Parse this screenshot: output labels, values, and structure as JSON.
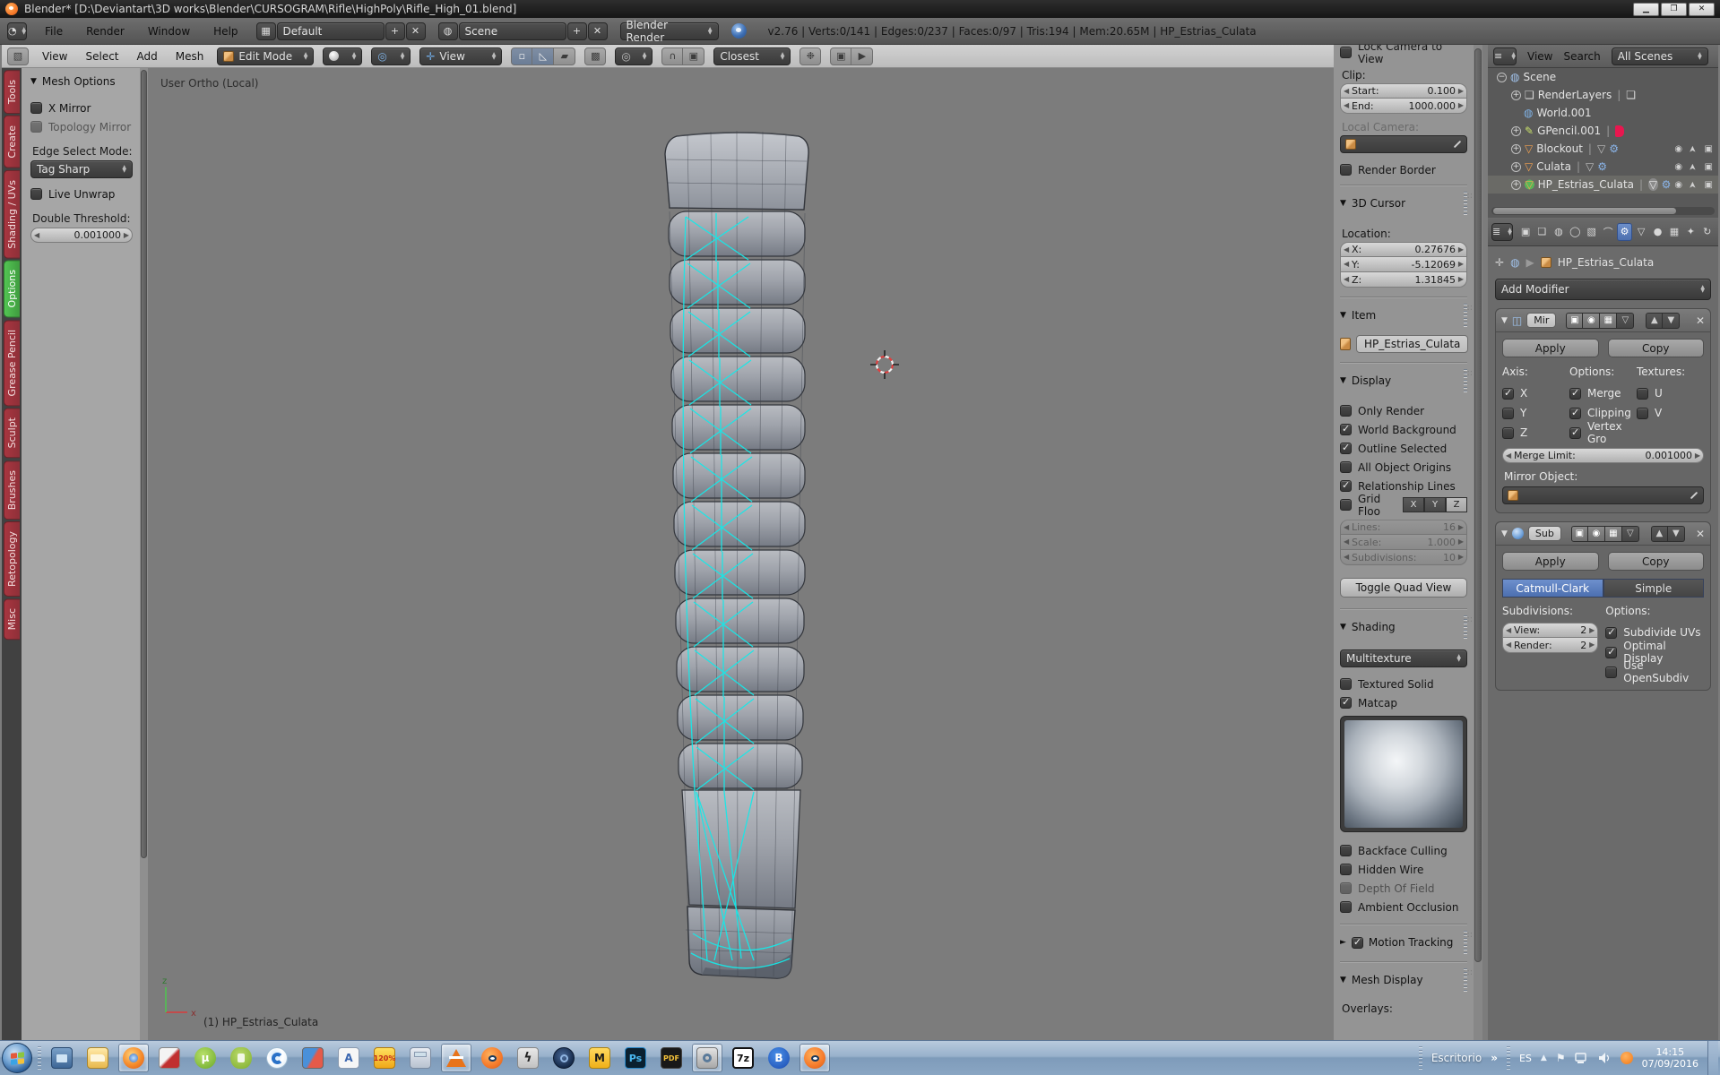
{
  "window": {
    "title": "Blender* [D:\\Deviantart\\3D works\\Blender\\CURSOGRAM\\Rifle\\HighPoly\\Rifle_High_01.blend]"
  },
  "info": {
    "menus": [
      "File",
      "Render",
      "Window",
      "Help"
    ],
    "layout": "Default",
    "scene": "Scene",
    "engine": "Blender Render",
    "stats": "v2.76 | Verts:0/141 | Edges:0/237 | Faces:0/97 | Tris:194 | Mem:20.65M | HP_Estrias_Culata"
  },
  "viewhdr": {
    "menus": [
      "View",
      "Select",
      "Add",
      "Mesh"
    ],
    "mode": "Edit Mode",
    "orientation": "View",
    "snap": "Closest"
  },
  "tools": {
    "tabs": [
      "Tools",
      "Create",
      "Shading / UVs",
      "Options",
      "Grease Pencil",
      "Sculpt",
      "Brushes",
      "Retopology",
      "Misc"
    ],
    "active_tab": "Options",
    "panel": "Mesh Options",
    "x_mirror": "X Mirror",
    "topology_mirror": "Topology Mirror",
    "edge_mode_label": "Edge Select Mode:",
    "edge_mode": "Tag Sharp",
    "live_unwrap": "Live Unwrap",
    "threshold_label": "Double Threshold:",
    "threshold": "0.001000"
  },
  "viewport": {
    "view_label": "User Ortho (Local)",
    "object_label": "(1) HP_Estrias_Culata"
  },
  "npanel": {
    "lock_camera": "Lock Camera to View",
    "clip": "Clip:",
    "start_label": "Start:",
    "start": "0.100",
    "end_label": "End:",
    "end": "1000.000",
    "local_camera": "Local Camera:",
    "render_border": "Render Border",
    "cursor": "3D Cursor",
    "location": "Location:",
    "loc": [
      {
        "k": "X:",
        "v": "0.27676"
      },
      {
        "k": "Y:",
        "v": "-5.12069"
      },
      {
        "k": "Z:",
        "v": "1.31845"
      }
    ],
    "item": "Item",
    "item_name": "HP_Estrias_Culata",
    "display": "Display",
    "display_items": [
      {
        "label": "Only Render",
        "on": false
      },
      {
        "label": "World Background",
        "on": true
      },
      {
        "label": "Outline Selected",
        "on": true
      },
      {
        "label": "All Object Origins",
        "on": false
      },
      {
        "label": "Relationship Lines",
        "on": true
      }
    ],
    "grid_floor": "Grid Floo",
    "axes": [
      "X",
      "Y",
      "Z"
    ],
    "grid_sliders": [
      {
        "k": "Lines:",
        "v": "16"
      },
      {
        "k": "Scale:",
        "v": "1.000"
      },
      {
        "k": "Subdivisions:",
        "v": "10"
      }
    ],
    "toggle_quad": "Toggle Quad View",
    "shading": "Shading",
    "shading_mode": "Multitexture",
    "textured_solid": "Textured Solid",
    "matcap": "Matcap",
    "shade_items": [
      {
        "label": "Backface Culling",
        "on": false
      },
      {
        "label": "Hidden Wire",
        "on": false
      },
      {
        "label": "Depth Of Field",
        "on": false
      },
      {
        "label": "Ambient Occlusion",
        "on": false
      }
    ],
    "motion_tracking": "Motion Tracking",
    "mesh_display": "Mesh Display",
    "overlays": "Overlays:"
  },
  "outliner": {
    "menus": [
      "View",
      "Search"
    ],
    "scope": "All Scenes",
    "rows": [
      {
        "label": "Scene"
      },
      {
        "label": "RenderLayers"
      },
      {
        "label": "World.001"
      },
      {
        "label": "GPencil.001"
      },
      {
        "label": "Blockout"
      },
      {
        "label": "Culata"
      },
      {
        "label": "HP_Estrias_Culata"
      }
    ]
  },
  "props": {
    "object": "HP_Estrias_Culata",
    "add_modifier": "Add Modifier",
    "mirror": {
      "name": "Mir",
      "apply": "Apply",
      "copy": "Copy",
      "axis_label": "Axis:",
      "options_label": "Options:",
      "textures_label": "Textures:",
      "axis": [
        {
          "label": "X",
          "on": true
        },
        {
          "label": "Y",
          "on": false
        },
        {
          "label": "Z",
          "on": false
        }
      ],
      "options": [
        {
          "label": "Merge",
          "on": true
        },
        {
          "label": "Clipping",
          "on": true
        },
        {
          "label": "Vertex Gro",
          "on": true
        }
      ],
      "textures": [
        {
          "label": "U",
          "on": false
        },
        {
          "label": "V",
          "on": false
        }
      ],
      "merge_limit_label": "Merge Limit:",
      "merge_limit": "0.001000",
      "mirror_object": "Mirror Object:"
    },
    "subsurf": {
      "name": "Sub",
      "apply": "Apply",
      "copy": "Copy",
      "type_a": "Catmull-Clark",
      "type_b": "Simple",
      "subdivisions": "Subdivisions:",
      "options_label": "Options:",
      "view_label": "View:",
      "view": "2",
      "render_label": "Render:",
      "render": "2",
      "options": [
        {
          "label": "Subdivide UVs",
          "on": true
        },
        {
          "label": "Optimal Display",
          "on": true
        },
        {
          "label": "Use OpenSubdiv",
          "on": false
        }
      ]
    }
  },
  "taskbar": {
    "desktop": "Escritorio",
    "chevron": "»",
    "lang": "ES",
    "time": "14:15",
    "date": "07/09/2016",
    "glyphs": {
      "utorrent": "µ",
      "photoshop": "Ps",
      "pdf": "PDF",
      "sevenzip": "7z",
      "magicdisc": "M",
      "percent": "120%"
    }
  },
  "colors": {
    "accent_blue": "#4c6fb0",
    "tab_red": "#a83640",
    "tab_green": "#53c553",
    "select_cyan": "#17e8e8",
    "blender_orange": "#f5792a"
  }
}
